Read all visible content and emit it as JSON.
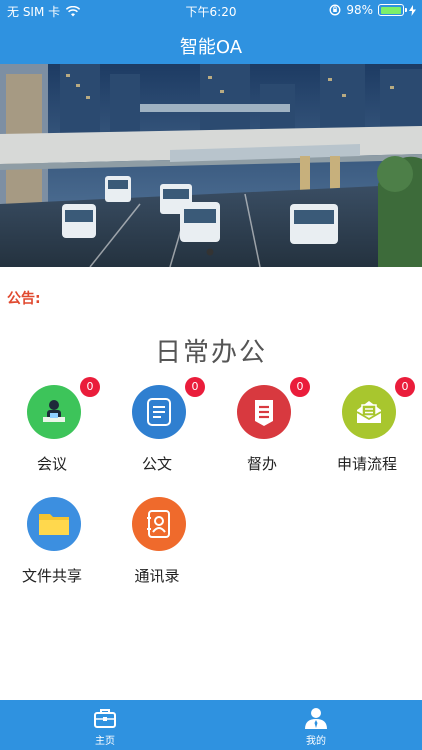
{
  "status_bar": {
    "carrier": "无 SIM 卡",
    "time": "下午6:20",
    "battery": "98%",
    "battery_level": 0.98
  },
  "header": {
    "title": "智能OA"
  },
  "notice": {
    "label": "公告:"
  },
  "section": {
    "title": "日常办公"
  },
  "apps": [
    {
      "label": "会议",
      "badge": "0",
      "icon": "meeting-icon",
      "color": "#3dc45a"
    },
    {
      "label": "公文",
      "badge": "0",
      "icon": "document-icon",
      "color": "#2f7fd0"
    },
    {
      "label": "督办",
      "badge": "0",
      "icon": "supervise-icon",
      "color": "#d8393f"
    },
    {
      "label": "申请流程",
      "badge": "0",
      "icon": "mail-flow-icon",
      "color": "#a8c62e"
    },
    {
      "label": "文件共享",
      "icon": "folder-icon",
      "color": "#3c8fe0"
    },
    {
      "label": "通讯录",
      "icon": "contacts-icon",
      "color": "#ef6a2c"
    }
  ],
  "tabbar": {
    "tabs": [
      {
        "label": "主页",
        "icon": "briefcase-icon"
      },
      {
        "label": "我的",
        "icon": "user-icon"
      }
    ]
  }
}
